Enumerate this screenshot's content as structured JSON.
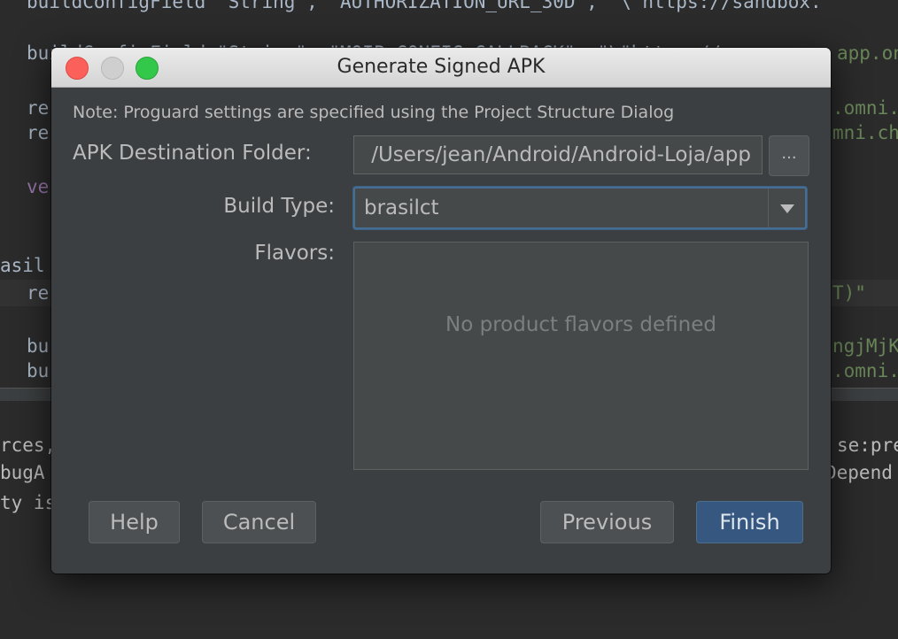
{
  "background_code": {
    "line1": "buildConfigField \"String\", \"AUTHORIZATION_URL_30D\", \"\\\"https://sandbox.",
    "line2a": "buildConfigField",
    "line2b": " \"String\", \"MOIP_CONFIG_CALLBACK\", \"\\\"https://",
    "line2c": "app.on",
    "line3a": "re",
    "line3b": ".omni.",
    "line4a": "re",
    "line4b": "mni.ch",
    "line5a": "ve",
    "line6a": "asil",
    "line7a": "re",
    "line7b": "T)\"",
    "line8a": "bu",
    "line8b": "ngjMjK",
    "line9a": "bu",
    "line9b": ".omni."
  },
  "console_text": {
    "line1a": "rces,",
    "line1b": "se:pre",
    "line2a": "bugA",
    "line2b": "Depend",
    "line3a": "ty is c"
  },
  "dialog": {
    "title": "Generate Signed APK",
    "note": "Note: Proguard settings are specified using the Project Structure Dialog",
    "destination_label": "APK Destination Folder:",
    "destination_value": "/Users/jean/Android/Android-Loja/app",
    "browse_label": "...",
    "build_type_label": "Build Type:",
    "build_type_value": "brasilct",
    "flavors_label": "Flavors:",
    "flavors_empty_text": "No product flavors defined",
    "buttons": {
      "help": "Help",
      "cancel": "Cancel",
      "previous": "Previous",
      "finish": "Finish"
    }
  },
  "colors": {
    "dialog_bg": "#3c3f41",
    "accent_primary": "#365880",
    "focus_border": "#466d94",
    "close": "#fc605b",
    "maximize": "#34c84a"
  }
}
